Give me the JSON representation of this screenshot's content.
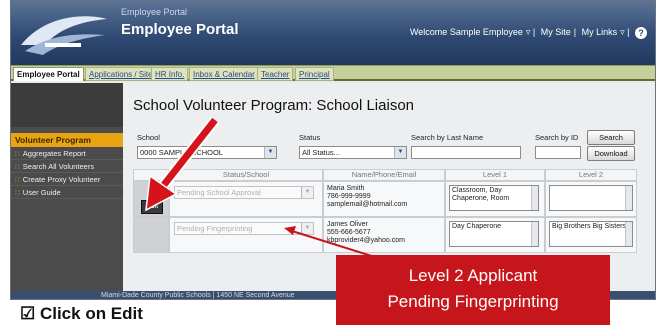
{
  "header": {
    "small_title": "Employee Portal",
    "title": "Employee Portal",
    "links": [
      "Welcome Sample Employee",
      "My Site",
      "My Links"
    ],
    "help_glyph": "?",
    "colors": {
      "header": "#2f4a73",
      "tabbar": "#c6d09c",
      "accent": "#e8a412"
    }
  },
  "tabs": [
    "Employee Portal",
    "Applications / Sites",
    "HR Info.",
    "Inbox & Calendar",
    "Teacher",
    "Principal"
  ],
  "sidebar": {
    "heading": "Volunteer Program",
    "items": [
      {
        "label": "Aggregates Report"
      },
      {
        "label": "Search All Volunteers"
      },
      {
        "label": "Create Proxy Volunteer"
      },
      {
        "label": "User Guide"
      }
    ]
  },
  "page": {
    "title": "School Volunteer Program: School Liaison",
    "labels": {
      "school": "School",
      "status": "Status",
      "last_name": "Search by Last Name",
      "id": "Search by ID"
    },
    "school_value": "0000 SAMPLE SCHOOL",
    "status_value": "All Status...",
    "search_button": "Search",
    "download_button": "Download"
  },
  "table": {
    "headers": [
      "Status/School",
      "Name/Phone/Email",
      "Level 1",
      "Level 2"
    ],
    "rows": [
      {
        "button": "Edit",
        "status": "Pending School Approval",
        "name": "Maria Smith",
        "phone": "786-999-9999",
        "email": "samplemail@hotmail.com",
        "level1": "Classroom, Day Chaperone, Room",
        "level2": ""
      },
      {
        "button": "",
        "status": "Pending Fingerprinting",
        "name": "James Oliver",
        "phone": "555-666-5677",
        "email": "kbprovider4@yahoo.com",
        "level1": "Day Chaperone",
        "level2": "Big Brothers Big Sisters"
      }
    ]
  },
  "footer": {
    "text": "Miami-Dade County Public Schools | 1450 NE Second Avenue"
  },
  "annotation": {
    "line1": "Level 2 Applicant",
    "line2": "Pending Fingerprinting",
    "color": "#c6161b"
  },
  "caption": "☑ Click on Edit"
}
